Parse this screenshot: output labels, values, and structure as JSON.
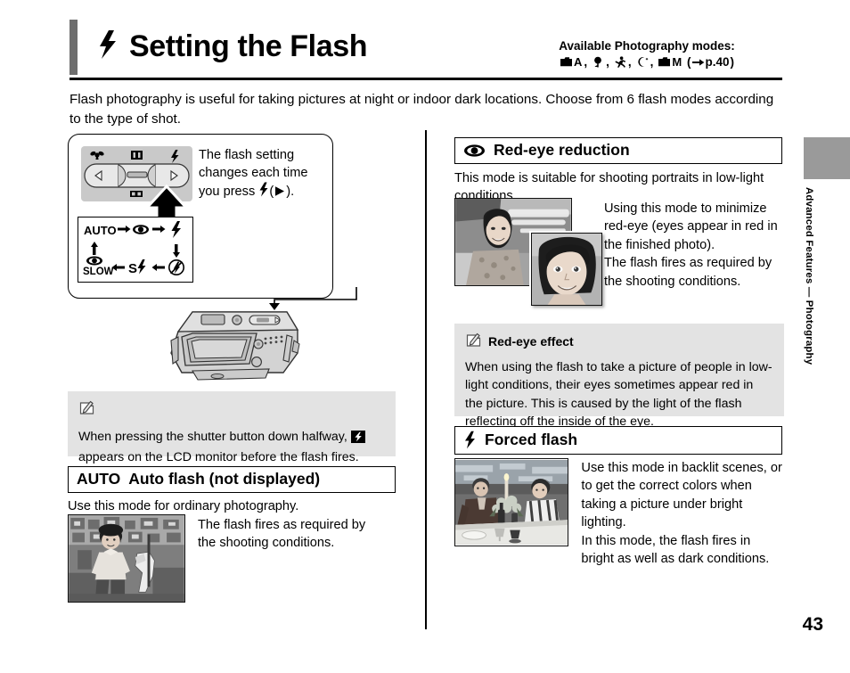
{
  "header": {
    "title": "Setting the Flash",
    "title_icon": "flash-icon",
    "modes_label": "Available Photography modes:",
    "modes": [
      {
        "icon": "camera-auto-icon",
        "label": "A"
      },
      {
        "icon": "portrait-icon",
        "label": ""
      },
      {
        "icon": "sports-icon",
        "label": ""
      },
      {
        "icon": "night-icon",
        "label": ""
      },
      {
        "icon": "camera-manual-icon",
        "label": "M"
      }
    ],
    "modes_reference": "p.40"
  },
  "intro": "Flash photography is useful for taking pictures at night or indoor dark locations. Choose from 6 flash modes according to the type of shot.",
  "flash_panel": {
    "caption_part1": "The flash setting changes each time you press",
    "caption_icon": "flash-icon",
    "caption_part2": "(",
    "caption_part3": ").",
    "caption_arrow_icon": "right-triangle-icon",
    "control_labels": [
      "macro-flower-icon",
      "zoom-icon",
      "flash-icon"
    ],
    "cycle": [
      {
        "icon": "auto-text",
        "label": "AUTO"
      },
      {
        "icon": "red-eye-icon",
        "label": ""
      },
      {
        "icon": "forced-flash-icon",
        "label": ""
      },
      {
        "icon": "flash-off-icon",
        "label": ""
      },
      {
        "icon": "slow-sync-icon",
        "label": "S"
      },
      {
        "icon": "red-eye-slow-icon",
        "label": "SLOW"
      }
    ]
  },
  "note_left": {
    "icon": "memo-icon",
    "body_part1": "When pressing the shutter button down halfway,",
    "body_icon": "flash-indicator-icon",
    "body_part2": "appears on the LCD monitor before the flash fires."
  },
  "auto_section": {
    "heading_prefix": "AUTO",
    "heading": "Auto flash (not displayed)",
    "subtitle": "Use this mode for ordinary photography.",
    "description": "The flash fires as required by the shooting conditions.",
    "photo_alt": "woman-at-carousel-photo"
  },
  "redeye_section": {
    "icon": "red-eye-icon",
    "heading": "Red-eye reduction",
    "subtitle": "This mode is suitable for shooting portraits in low-light conditions.",
    "description": "Using this mode to minimize red-eye (eyes appear in red in the finished photo).\nThe flash fires as required by the shooting conditions.",
    "photo_alt": "two-women-portrait-photo"
  },
  "note_right": {
    "icon": "memo-icon",
    "title": "Red-eye effect",
    "body": "When using the flash to take a picture of people in low-light conditions, their eyes sometimes appear red in the picture. This is caused by the light of the flash reflecting off the inside of the eye."
  },
  "forced_section": {
    "icon": "forced-flash-icon",
    "heading": "Forced flash",
    "description": "Use this mode in backlit scenes, or to get the correct colors when taking a picture under bright lighting.\nIn this mode, the flash fires in bright as well as dark conditions.",
    "photo_alt": "dinner-table-couple-photo"
  },
  "side_tab": {
    "text": "Advanced Features — Photography",
    "color": "#9a9a9a"
  },
  "page_number": "43"
}
